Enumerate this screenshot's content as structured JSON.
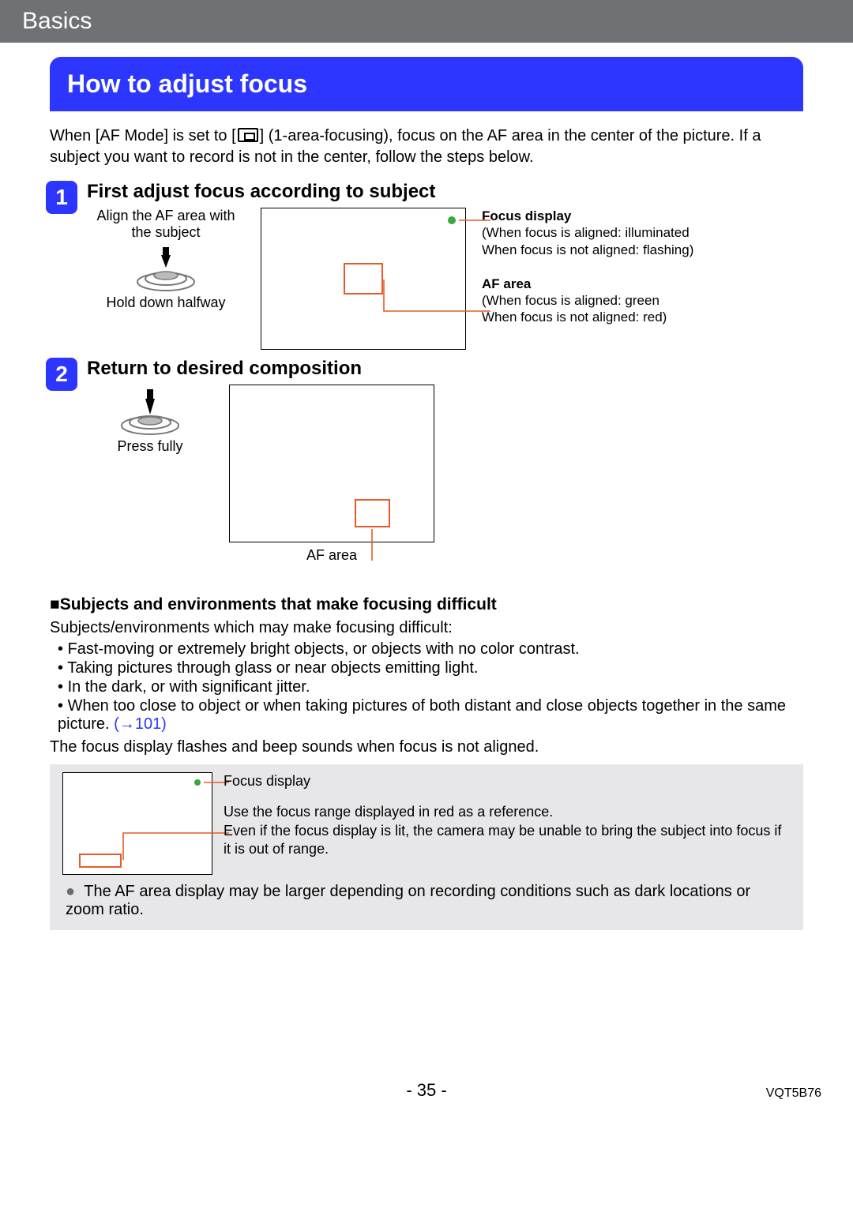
{
  "header": {
    "section": "Basics"
  },
  "banner": {
    "title": "How to adjust focus"
  },
  "intro": {
    "before_icon": "When [AF Mode] is set to [",
    "after_icon": "] (1-area-focusing), focus on the AF area in the center of the picture. If a subject you want to record is not in the center, follow the steps below."
  },
  "steps": {
    "one": {
      "num": "1",
      "title": "First adjust focus according to subject",
      "shutter_top": "Align the AF area with the subject",
      "shutter_bottom": "Hold down halfway",
      "callout_focus": {
        "title": "Focus display",
        "line1": "(When focus is aligned: illuminated",
        "line2": " When focus is not aligned: flashing)"
      },
      "callout_af": {
        "title": "AF area",
        "line1": "(When focus is aligned: green",
        "line2": " When focus is not aligned: red)"
      }
    },
    "two": {
      "num": "2",
      "title": "Return to desired composition",
      "shutter_bottom": "Press fully",
      "af_label": "AF area"
    }
  },
  "subjects": {
    "heading_prefix": "■",
    "heading": "Subjects and environments that make focusing difficult",
    "intro": "Subjects/environments which may make focusing difficult:",
    "b1": "Fast-moving or extremely bright objects, or objects with no color contrast.",
    "b2": "Taking pictures through glass or near objects emitting light.",
    "b3": "In the dark, or with significant jitter.",
    "b4": "When too close to object or when taking pictures of both distant and close objects together in the same picture.",
    "link": "(→101)",
    "note": "The focus display flashes and beep sounds when focus is not aligned."
  },
  "graybox": {
    "c1": "Focus display",
    "c2": "Use the focus range displayed in red as a reference.",
    "c2b": "Even if the focus display is lit, the camera may be unable to bring the subject into focus if it is out of range.",
    "bullet": "The AF area display may be larger depending on recording conditions such as dark locations or zoom ratio."
  },
  "footer": {
    "page": "- 35 -",
    "code": "VQT5B76"
  }
}
